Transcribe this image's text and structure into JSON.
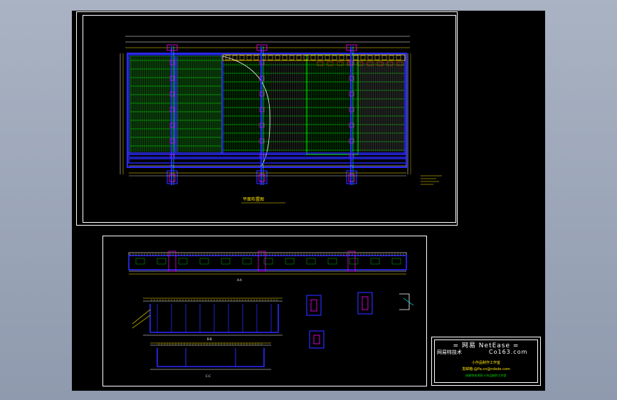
{
  "colors": {
    "background": "#98a3b5",
    "drawing_area": "#000000",
    "frame": "#ffffff",
    "blue": "#2a2aff",
    "green": "#00e600",
    "yellow": "#ffe600",
    "magenta": "#ff00ff",
    "cyan": "#00ffff",
    "red": "#ff2020",
    "white": "#ffffff"
  },
  "title_block": {
    "line1": "=   网易 NetEase  =",
    "line2_left": "网易特技术",
    "line2_right": "Co163.com",
    "line3": "小作品制作工作室",
    "line4": "发邮箱:@Pa.cn@ndsde.com",
    "line5": "网易特技术网 小作品制作工作室"
  },
  "labels": {
    "plan_title": "平面布置图",
    "section_a": "A-A",
    "section_b": "B-B",
    "section_c": "C-C"
  }
}
